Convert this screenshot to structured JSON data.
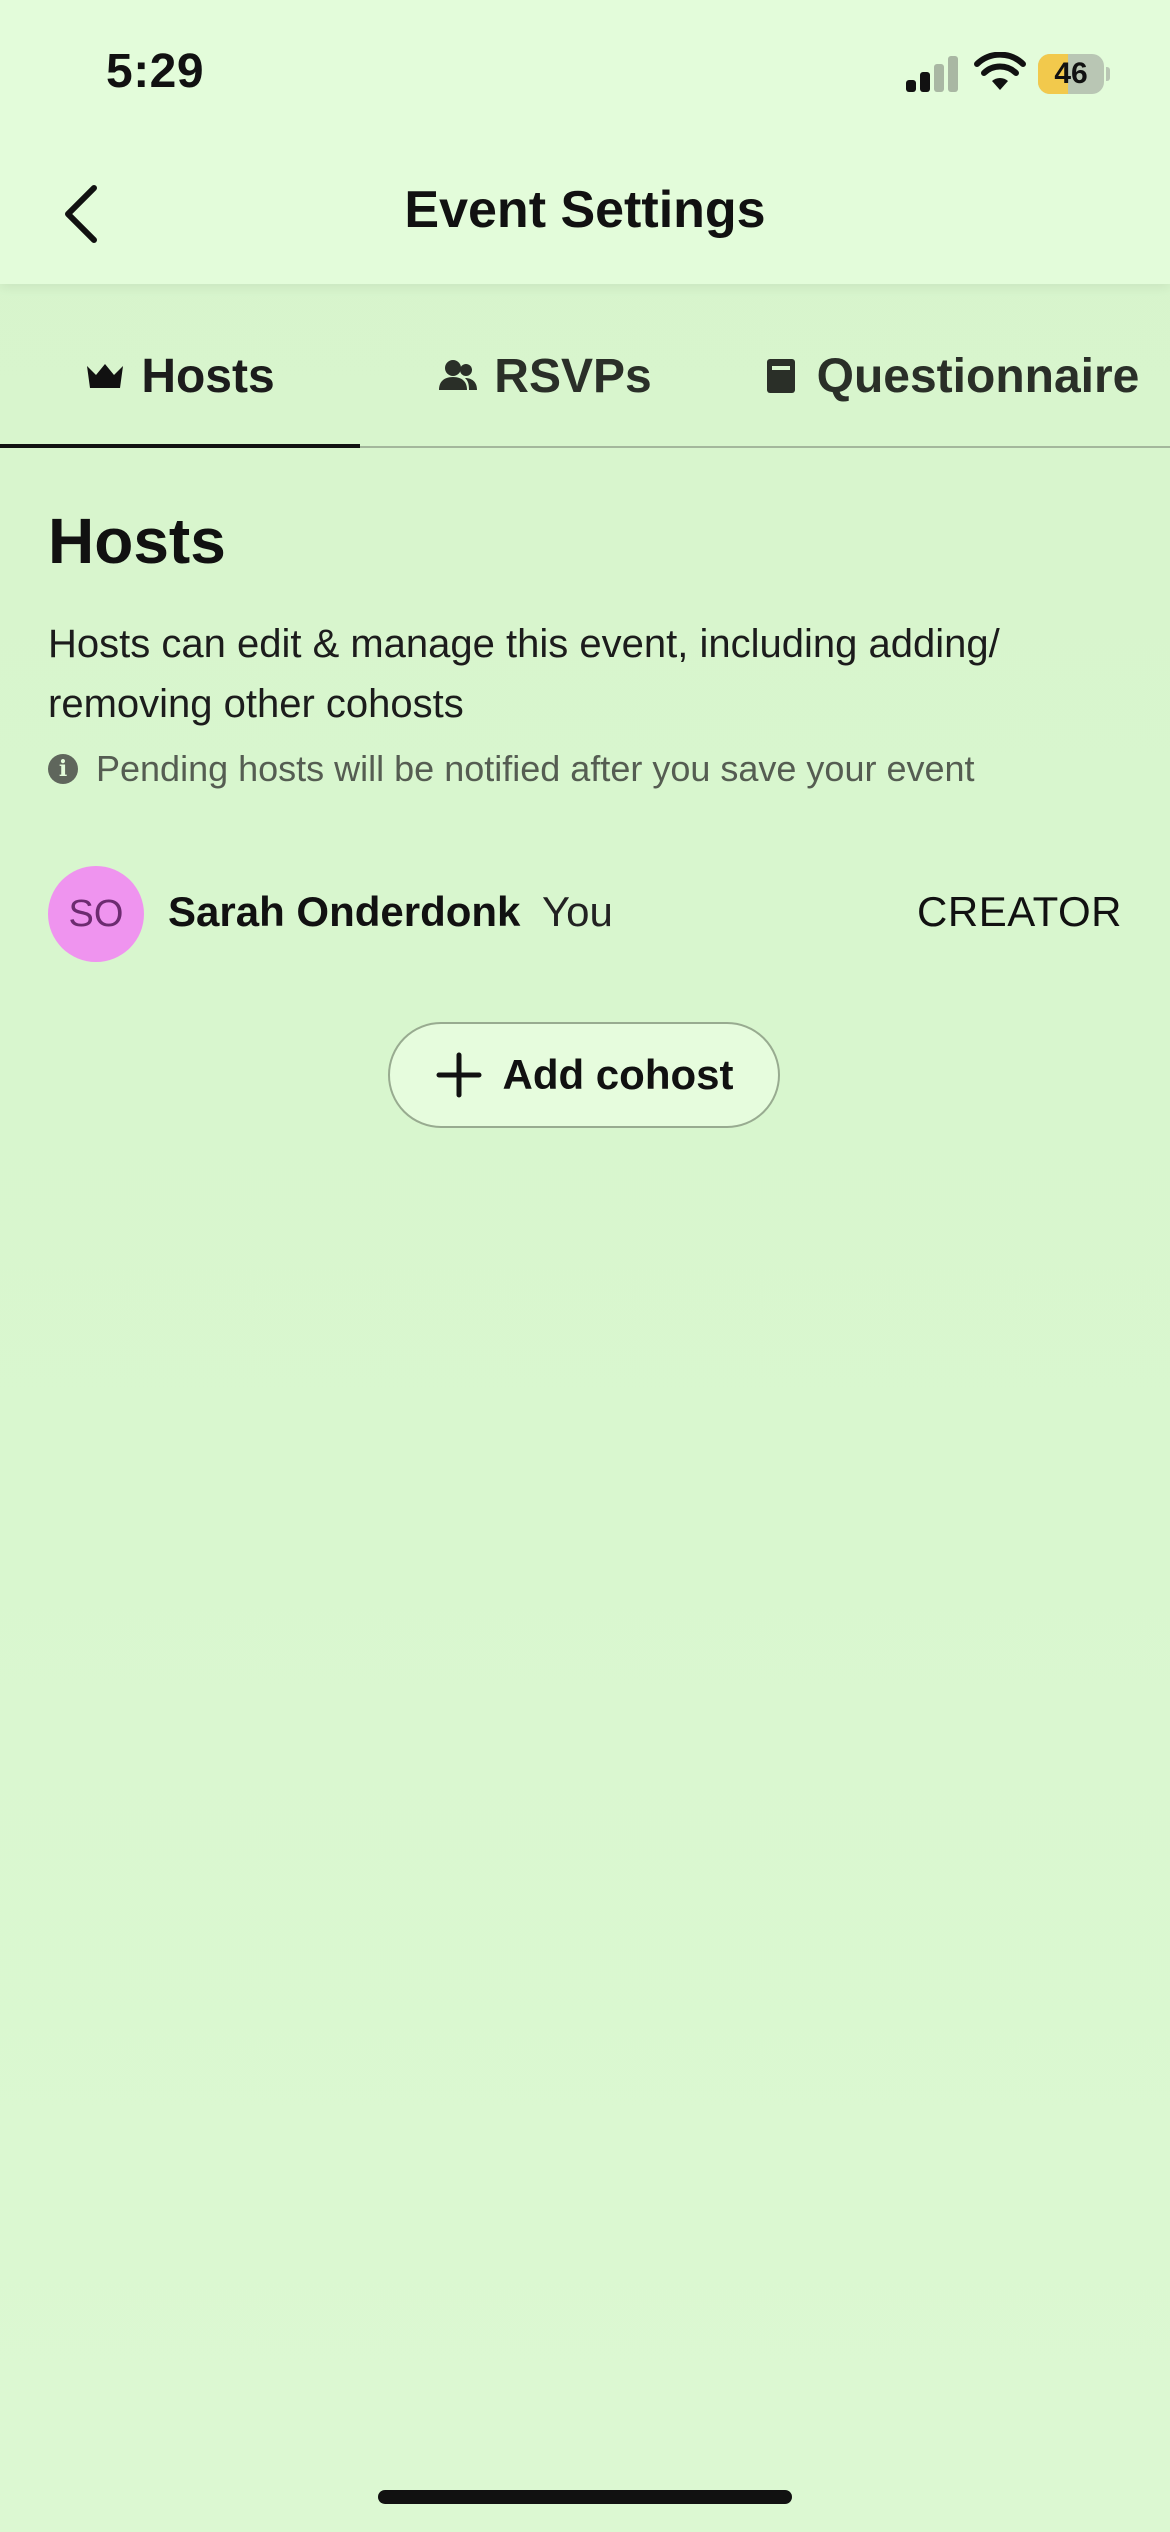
{
  "status_bar": {
    "time": "5:29",
    "battery_level": 46,
    "battery_text": "46",
    "battery_color": "#f2c94c",
    "signal_icon": "cellular-signal-icon",
    "wifi_icon": "wifi-icon"
  },
  "header": {
    "title": "Event Settings",
    "back_icon": "chevron-left-icon"
  },
  "tabs": [
    {
      "label": "Hosts",
      "icon": "crown-icon",
      "active": true
    },
    {
      "label": "RSVPs",
      "icon": "people-icon",
      "active": false
    },
    {
      "label": "Questionnaire",
      "icon": "document-icon",
      "active": false
    }
  ],
  "hosts_section": {
    "title": "Hosts",
    "description": "Hosts can edit & manage this event, including adding/ removing other cohosts",
    "info_text": "Pending hosts will be notified after you save your event",
    "info_icon": "info-icon"
  },
  "hosts": [
    {
      "initials": "SO",
      "name": "Sarah Onderdonk",
      "tag": "You",
      "role": "CREATOR",
      "avatar_color": "#ef94ef"
    }
  ],
  "add_cohost": {
    "label": "Add cohost",
    "icon": "plus-icon"
  },
  "colors": {
    "background": "#d9f6cf",
    "header_background": "#e3fcda",
    "text": "#111111"
  }
}
